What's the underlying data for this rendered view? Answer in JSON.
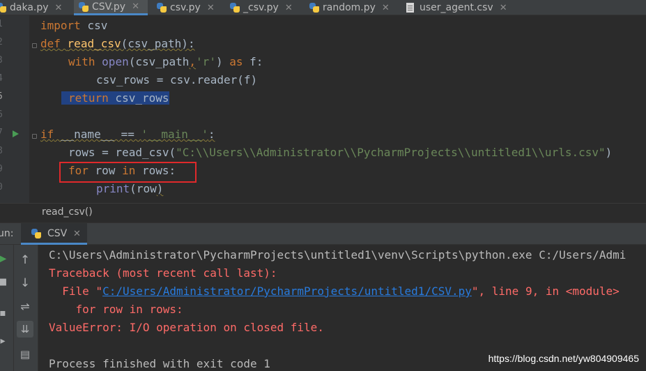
{
  "tabs": [
    {
      "label": "daka.py",
      "icon": "python-file-icon",
      "active": false
    },
    {
      "label": "CSV.py",
      "icon": "python-file-icon",
      "active": true
    },
    {
      "label": "csv.py",
      "icon": "python-file-icon",
      "active": false
    },
    {
      "label": "_csv.py",
      "icon": "python-file-icon",
      "active": false
    },
    {
      "label": "random.py",
      "icon": "python-file-icon",
      "active": false
    },
    {
      "label": "user_agent.csv",
      "icon": "csv-file-icon",
      "active": false
    }
  ],
  "tab_close_glyph": "✕",
  "editor": {
    "line_numbers": [
      "1",
      "2",
      "3",
      "4",
      "5",
      "6",
      "7",
      "8",
      "9",
      "0"
    ],
    "current_line": "5",
    "code": {
      "l1_kw": "import",
      "l1_rest": " csv",
      "l2_kw": "def",
      "l2_fn": "read_csv",
      "l2_rest": "(csv_path):",
      "l3_kw": "with",
      "l3_bi": "open",
      "l3_a": "(csv_path",
      "l3_b": ",",
      "l3_str": "'r'",
      "l3_c": ") ",
      "l3_kw2": "as",
      "l3_d": " f:",
      "l4": "csv_rows = csv.reader(f)",
      "l5_kw": "return",
      "l5_rest": " csv_rows",
      "l7_kw": "if",
      "l7_a": " __name__ == ",
      "l7_str": "'__main__'",
      "l7_b": ":",
      "l8_a": "rows = read_csv(",
      "l8_str": "\"C:\\\\Users\\\\Administrator\\\\PycharmProjects\\\\untitled1\\\\urls.csv\"",
      "l8_b": ")",
      "l9_kw": "for",
      "l9_a": " row ",
      "l9_kw2": "in",
      "l9_b": " rows:",
      "l10_bi": "print",
      "l10_a": "(row",
      "l10_b": ")"
    },
    "breadcrumb": "read_csv()"
  },
  "run_panel": {
    "label": "un:",
    "tab_label": "CSV",
    "tools": [
      "rerun-icon",
      "stop-icon",
      "scroll-up-icon",
      "scroll-down-icon",
      "soft-wrap-icon",
      "scroll-to-end-icon",
      "pin-icon",
      "print-icon"
    ],
    "output": {
      "line1": "C:\\Users\\Administrator\\PycharmProjects\\untitled1\\venv\\Scripts\\python.exe C:/Users/Admi",
      "line2": "Traceback (most recent call last):",
      "line3_a": "  File \"",
      "line3_link": "C:/Users/Administrator/PycharmProjects/untitled1/CSV.py",
      "line3_b": "\", line 9, in <module>",
      "line4": "    for row in rows:",
      "line5": "ValueError: I/O operation on closed file.",
      "line7": "Process finished with exit code 1"
    }
  },
  "watermark": "https://blog.csdn.net/yw804909465"
}
